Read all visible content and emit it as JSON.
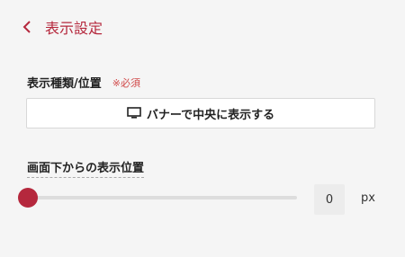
{
  "header": {
    "title": "表示設定"
  },
  "display_type": {
    "label": "表示種類/位置",
    "required": "※必須",
    "button_label": "バナーで中央に表示する",
    "button_icon": "monitor-icon"
  },
  "position": {
    "label": "画面下からの表示位置",
    "slider_fraction": 0,
    "value": "0",
    "unit": "px"
  },
  "colors": {
    "accent": "#b5283d",
    "required": "#d04848"
  }
}
